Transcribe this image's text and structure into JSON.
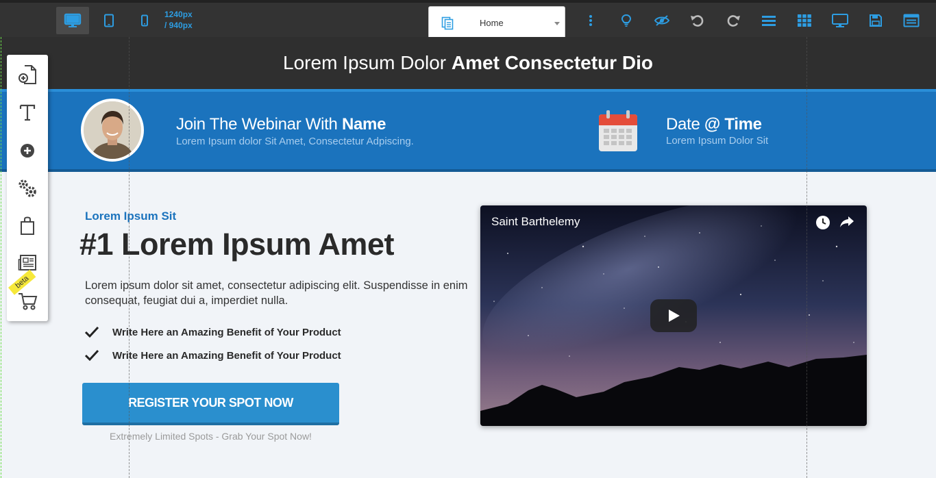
{
  "toolbar": {
    "devices": [
      {
        "name": "desktop-view",
        "icon": "monitor-icon",
        "active": true
      },
      {
        "name": "tablet-view",
        "icon": "tablet-icon",
        "active": false
      },
      {
        "name": "mobile-view",
        "icon": "phone-icon",
        "active": false
      }
    ],
    "size_line1": "1240px",
    "size_line2": "/ 940px",
    "page_select": {
      "value": "Home",
      "icon": "pages-icon"
    },
    "actions": [
      {
        "name": "more-options",
        "icon": "vertical-dots-icon"
      },
      {
        "name": "tips",
        "icon": "lightbulb-icon"
      },
      {
        "name": "preview",
        "icon": "eye-icon"
      },
      {
        "name": "undo",
        "icon": "undo-icon"
      },
      {
        "name": "redo",
        "icon": "redo-icon"
      },
      {
        "name": "sections",
        "icon": "list-icon"
      },
      {
        "name": "grid",
        "icon": "grid-icon"
      },
      {
        "name": "desktop-preview",
        "icon": "monitor-icon"
      },
      {
        "name": "save",
        "icon": "save-icon"
      },
      {
        "name": "publish",
        "icon": "browser-icon"
      }
    ],
    "accent": "#2d9de2",
    "background": "#333333"
  },
  "sidebar": {
    "items": [
      {
        "name": "add-page",
        "icon": "page-add-icon"
      },
      {
        "name": "add-text",
        "icon": "text-icon"
      },
      {
        "name": "add-element",
        "icon": "plus-circle-icon"
      },
      {
        "name": "settings",
        "icon": "gears-icon"
      },
      {
        "name": "products",
        "icon": "bag-icon"
      },
      {
        "name": "blog",
        "icon": "newspaper-icon"
      },
      {
        "name": "cart",
        "icon": "cart-icon"
      }
    ],
    "beta_label": "beta"
  },
  "page": {
    "headline_regular": "Lorem Ipsum Dolor ",
    "headline_bold": "Amet Consectetur Dio",
    "webinar": {
      "host_prefix": "Join The Webinar With ",
      "host_name": "Name",
      "host_sub": "Lorem Ipsum dolor Sit Amet, Consectetur Adpiscing.",
      "date_prefix": "Date ",
      "date_bold": "@ Time",
      "date_sub": "Lorem Ipsum Dolor Sit",
      "bar_color": "#1b73bd"
    },
    "eyebrow": "Lorem Ipsum Sit",
    "heading": "#1 Lorem Ipsum Amet",
    "body": "Lorem ipsum dolor sit amet, consectetur adipiscing elit. Suspendisse in enim consequat, feugiat dui a, imperdiet nulla.",
    "benefits": [
      "Write Here an Amazing Benefit of Your Product",
      "Write Here an Amazing Benefit of Your Product"
    ],
    "cta_label": "REGISTER YOUR SPOT NOW",
    "cta_note": "Extremely Limited Spots - Grab Your Spot Now!",
    "video": {
      "title": "Saint Barthelemy",
      "icons": [
        "clock-icon",
        "share-icon",
        "play-icon"
      ]
    }
  }
}
